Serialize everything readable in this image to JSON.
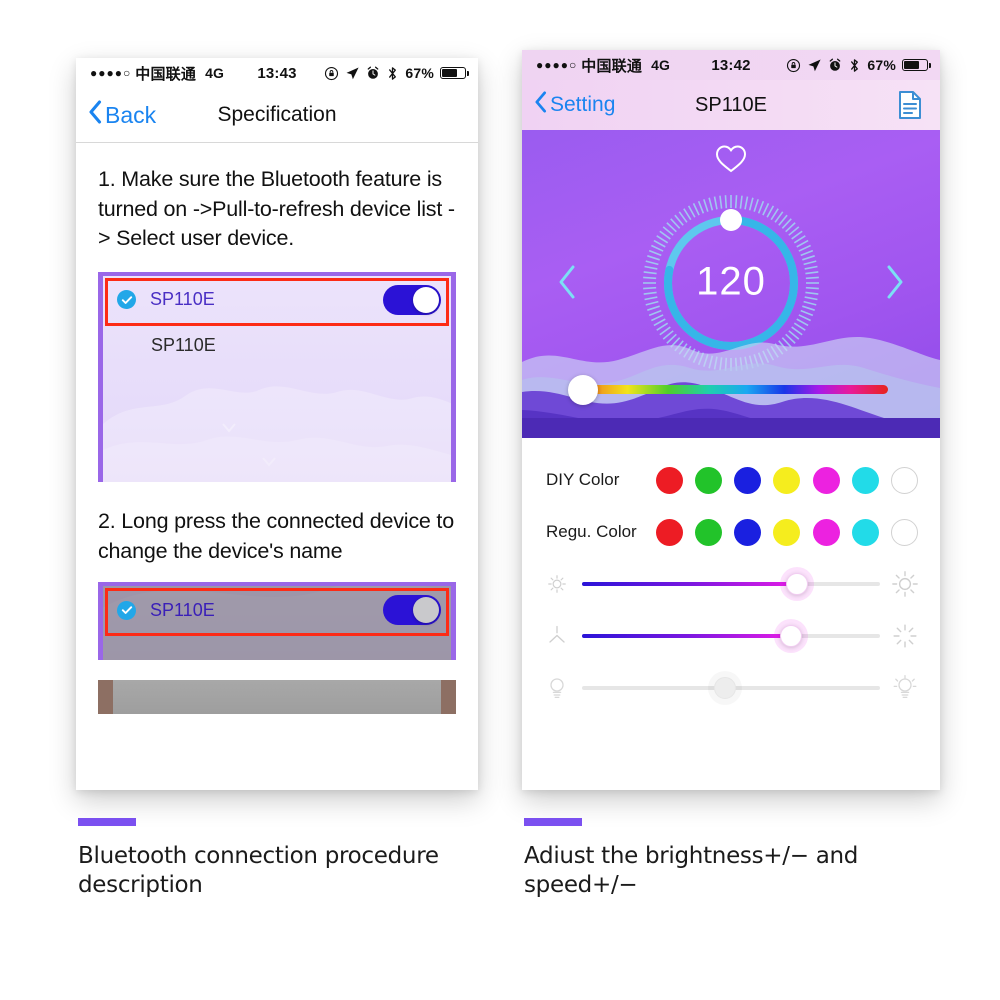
{
  "left_phone": {
    "status_bar": {
      "signal_dots": "●●●●○",
      "carrier": "中国联通",
      "network": "4G",
      "time": "13:43",
      "battery_percent": "67%",
      "battery_level": 67,
      "icons": [
        "rotation-lock-icon",
        "location-arrow-icon",
        "alarm-clock-icon",
        "bluetooth-icon"
      ]
    },
    "navbar": {
      "back_label": "Back",
      "title": "Specification"
    },
    "steps": [
      {
        "text": "1. Make sure the Bluetooth feature is turned on ->Pull-to-refresh device list -> Select user device."
      },
      {
        "text": "2. Long press the connected device to change the device's name"
      }
    ],
    "device_panel_1": {
      "selected_device": "SP110E",
      "second_device": "SP110E",
      "toggle_on": true
    },
    "device_panel_2": {
      "selected_device": "SP110E",
      "toggle_on": true,
      "dimmed": true
    },
    "highlight_color": "#fd2b16"
  },
  "right_phone": {
    "status_bar": {
      "signal_dots": "●●●●○",
      "carrier": "中国联通",
      "network": "4G",
      "time": "13:42",
      "battery_percent": "67%",
      "battery_level": 67,
      "icons": [
        "rotation-lock-icon",
        "location-arrow-icon",
        "alarm-clock-icon",
        "bluetooth-icon"
      ]
    },
    "navbar": {
      "back_label": "Setting",
      "title": "SP110E",
      "action_icon": "document-icon"
    },
    "dial": {
      "value": "120",
      "favorite_icon": "heart-outline-icon",
      "prev_icon": "chevron-left-icon",
      "next_icon": "chevron-right-icon",
      "ring_progress_percent": 78,
      "thumb_position_percent": 50
    },
    "hue_slider": {
      "value_percent": 0,
      "name": "color-hue-slider"
    },
    "color_rows": [
      {
        "label": "DIY Color",
        "swatches": [
          "#ed1c24",
          "#22c32a",
          "#1a20e0",
          "#f5ed1e",
          "#ec22e0",
          "#22dbe8",
          "#ffffff"
        ]
      },
      {
        "label": "Regu. Color",
        "swatches": [
          "#ed1c24",
          "#22c32a",
          "#1a20e0",
          "#f5ed1e",
          "#ec22e0",
          "#22dbe8",
          "#ffffff"
        ]
      }
    ],
    "sliders": [
      {
        "name": "brightness-slider",
        "left_icon": "sun-small-icon",
        "right_icon": "sun-large-icon",
        "value_percent": 72,
        "active": true
      },
      {
        "name": "speed-slider",
        "left_icon": "speed-slow-icon",
        "right_icon": "speed-fast-icon",
        "value_percent": 70,
        "active": true
      },
      {
        "name": "bulb-slider",
        "left_icon": "bulb-dim-icon",
        "right_icon": "bulb-bright-icon",
        "value_percent": 48,
        "active": false
      }
    ]
  },
  "captions": {
    "left": "Bluetooth connection procedure description",
    "right": "Adiust the brightness+/− and speed+/−",
    "bar_color": "#7b50f0"
  }
}
